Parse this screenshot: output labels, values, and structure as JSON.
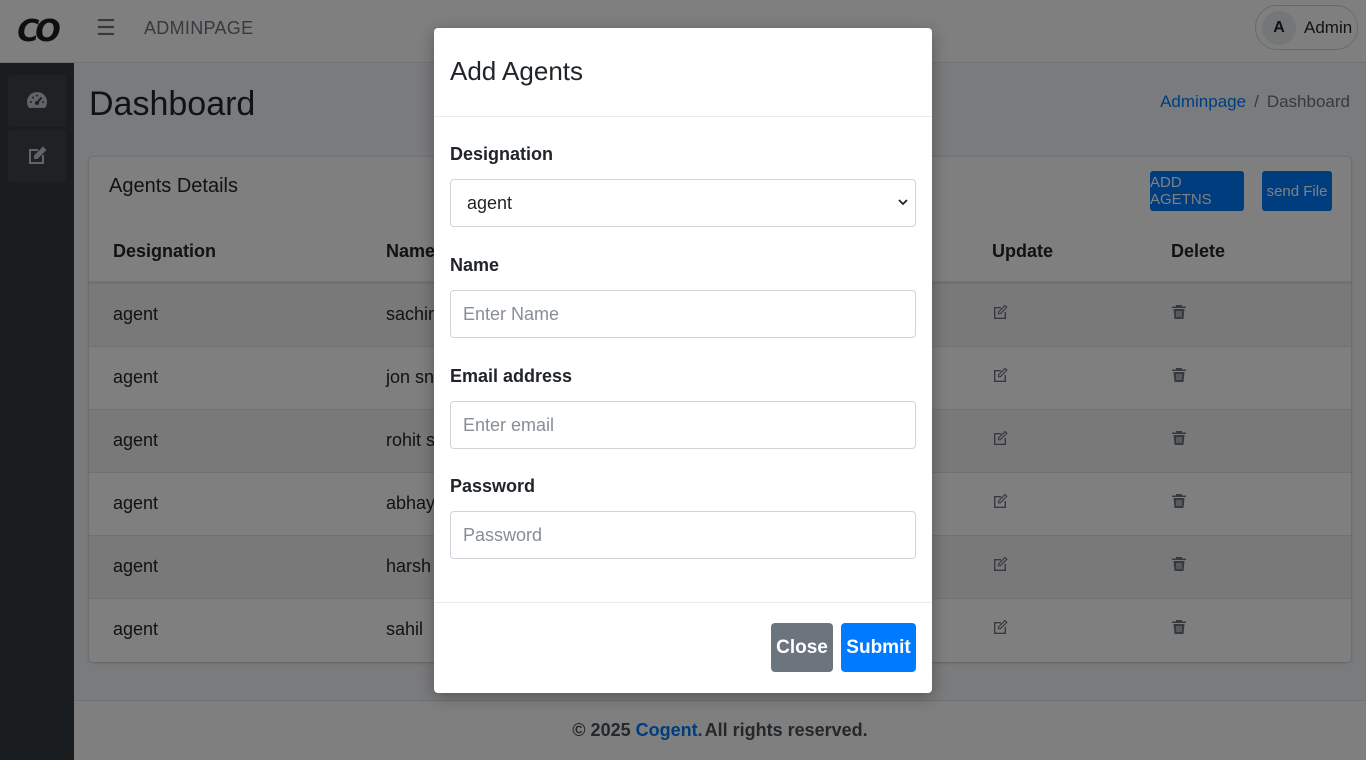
{
  "brand": {
    "logo_text": "CO"
  },
  "navbar": {
    "menu_icon": "hamburger-icon",
    "title": "ADMINPAGE"
  },
  "user": {
    "avatar_letter": "A",
    "name": "Admin"
  },
  "sidebar": {
    "items": [
      {
        "icon": "dashboard-gauge-icon"
      },
      {
        "icon": "edit-icon"
      }
    ]
  },
  "page": {
    "title": "Dashboard",
    "breadcrumb": {
      "link": "Adminpage",
      "separator": "/",
      "current": "Dashboard"
    }
  },
  "card": {
    "title": "Agents Details",
    "add_button": "ADD AGETNS",
    "send_button": "send File",
    "columns": {
      "designation": "Designation",
      "name": "Name",
      "update": "Update",
      "delete": "Delete"
    },
    "rows": [
      {
        "designation": "agent",
        "name": "sachin"
      },
      {
        "designation": "agent",
        "name": "jon sno"
      },
      {
        "designation": "agent",
        "name": "rohit si"
      },
      {
        "designation": "agent",
        "name": "abhay s"
      },
      {
        "designation": "agent",
        "name": "harsh"
      },
      {
        "designation": "agent",
        "name": "sahil"
      }
    ]
  },
  "footer": {
    "prefix": "© 2025",
    "brand": "Cogent.",
    "suffix": "All rights reserved."
  },
  "modal": {
    "title": "Add Agents",
    "designation_label": "Designation",
    "designation_value": "agent",
    "name_label": "Name",
    "name_placeholder": "Enter Name",
    "email_label": "Email address",
    "email_placeholder": "Enter email",
    "password_label": "Password",
    "password_placeholder": "Password",
    "close_button": "Close",
    "submit_button": "Submit"
  },
  "colors": {
    "primary": "#007bff",
    "secondary": "#6c757d",
    "sidebar": "#343a40"
  }
}
